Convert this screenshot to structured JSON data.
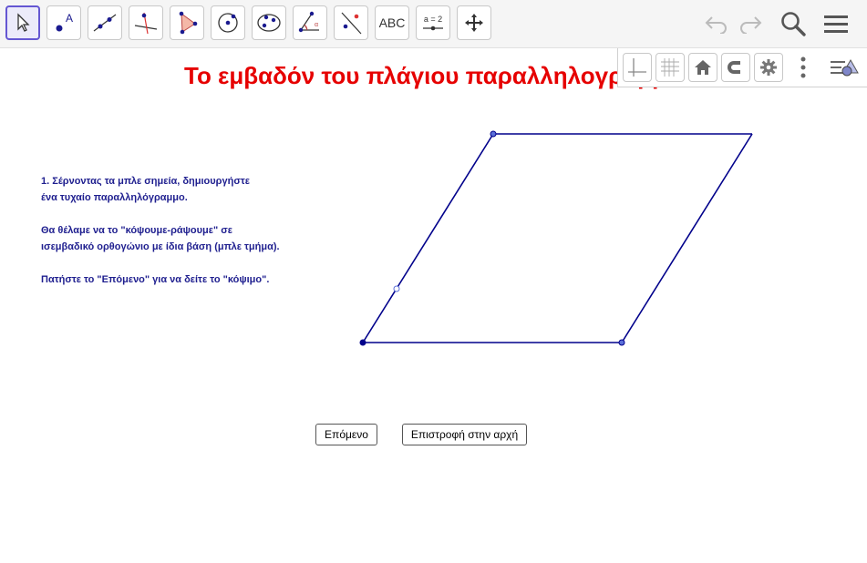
{
  "toolbar": {
    "tools": [
      {
        "name": "move-tool-icon"
      },
      {
        "name": "point-tool-icon"
      },
      {
        "name": "line-tool-icon"
      },
      {
        "name": "perpendicular-line-tool-icon"
      },
      {
        "name": "polygon-tool-icon"
      },
      {
        "name": "circle-tool-icon"
      },
      {
        "name": "conic-tool-icon"
      },
      {
        "name": "angle-tool-icon"
      },
      {
        "name": "reflect-tool-icon"
      },
      {
        "name": "text-tool",
        "label": "ABC"
      },
      {
        "name": "slider-tool",
        "label": "a = 2"
      },
      {
        "name": "move-graphics-view-tool-icon"
      }
    ],
    "right": [
      "undo-icon",
      "redo-icon",
      "search-icon",
      "menu-icon"
    ]
  },
  "graphics_view_bar": [
    "axes-icon",
    "grid-icon",
    "home-icon",
    "magnet-icon",
    "gear-icon",
    "more-vert-icon",
    "style-bar-toggle-icon"
  ],
  "title": "Το εμβαδόν του πλάγιου παραλληλογράμμου",
  "instructions": [
    "1. Σέρνοντας τα μπλε σημεία, δημιουργήστε",
    "ένα τυχαίο παραλληλόγραμμο.",
    "Θα θέλαμε να το \"κόψουμε-ράψουμε\" σε",
    "ισεμβαδικό ορθογώνιο με ίδια βάση (μπλε τμήμα).",
    "Πατήστε το \"Επόμενο\" για να δείτε το \"κόψιμο\"."
  ],
  "buttons": {
    "next": "Επόμενο",
    "reset": "Επιστροφή στην αρχή"
  },
  "colors": {
    "accent": "#6557d2",
    "title": "#e60000",
    "text": "#1f1f8f",
    "shape": "#00008b"
  }
}
